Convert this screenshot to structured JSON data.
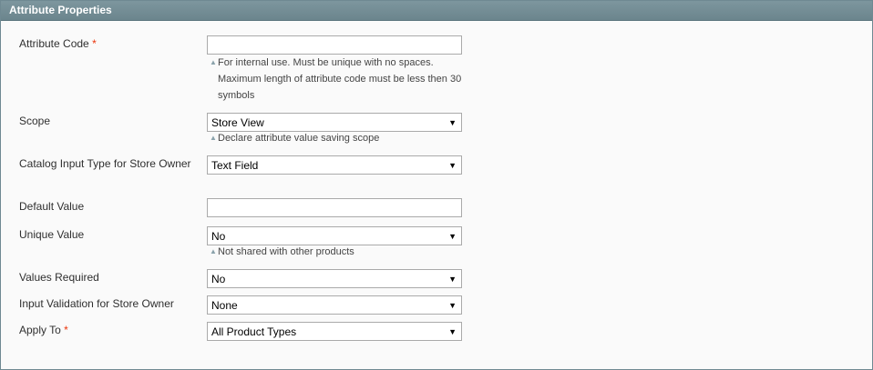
{
  "header": {
    "title": "Attribute Properties"
  },
  "fields": {
    "attribute_code": {
      "label": "Attribute Code",
      "required_mark": "*",
      "value": "",
      "note": "For internal use. Must be unique with no spaces. Maximum length of attribute code must be less then 30 symbols"
    },
    "scope": {
      "label": "Scope",
      "value": "Store View",
      "note": "Declare attribute value saving scope"
    },
    "input_type": {
      "label": "Catalog Input Type for Store Owner",
      "value": "Text Field"
    },
    "default_value": {
      "label": "Default Value",
      "value": ""
    },
    "unique_value": {
      "label": "Unique Value",
      "value": "No",
      "note": "Not shared with other products"
    },
    "values_required": {
      "label": "Values Required",
      "value": "No"
    },
    "input_validation": {
      "label": "Input Validation for Store Owner",
      "value": "None"
    },
    "apply_to": {
      "label": "Apply To",
      "required_mark": "*",
      "value": "All Product Types"
    }
  },
  "icons": {
    "dropdown": "dropdown-arrow-icon",
    "note": "note-triangle-icon"
  },
  "colors": {
    "header_bg": "#7d969e",
    "required": "#eb340a",
    "note_icon": "#8aa2ab"
  }
}
